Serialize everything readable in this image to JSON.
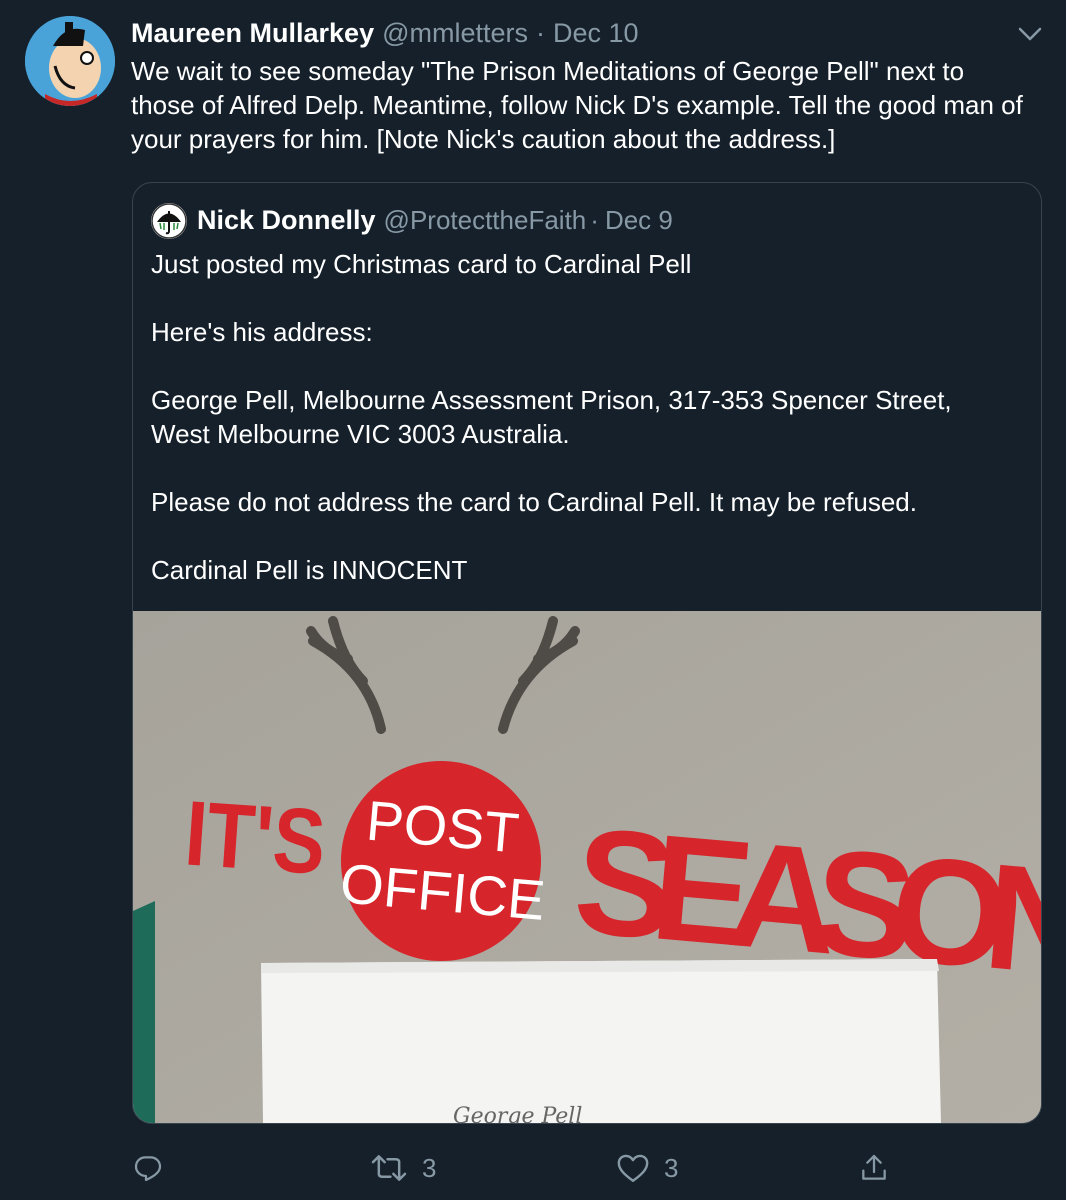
{
  "tweet": {
    "author_name": "Maureen Mullarkey",
    "author_handle": "@mmletters",
    "separator": "·",
    "date": "Dec 10",
    "text": "We wait to see someday \"The Prison Meditations of George Pell\" next to those of Alfred Delp. Meantime, follow Nick D's example. Tell the good man of your prayers for him. [Note Nick's caution about the address.]"
  },
  "quoted_tweet": {
    "author_name": "Nick Donnelly",
    "author_handle": "@ProtecttheFaith",
    "separator": "·",
    "date": "Dec 9",
    "paragraphs": [
      "Just posted my Christmas card to Cardinal Pell",
      "Here's his address:",
      "George Pell, Melbourne Assessment Prison, 317-353 Spencer Street, West Melbourne VIC 3003 Australia.",
      "Please do not address the card to Cardinal Pell. It may be refused.",
      "Cardinal Pell is INNOCENT"
    ],
    "photo": {
      "sign_left": "IT'S",
      "roundel_line1": "POST",
      "roundel_line2": "OFFICE",
      "sign_right": "SEASON",
      "envelope_text": "George Pell",
      "sign_red": "#d6252b"
    }
  },
  "actions": {
    "reply_icon": "reply-icon",
    "retweet_icon": "retweet-icon",
    "retweet_count": "3",
    "like_icon": "heart-icon",
    "like_count": "3",
    "share_icon": "share-icon",
    "muted_color": "#8899a6"
  }
}
